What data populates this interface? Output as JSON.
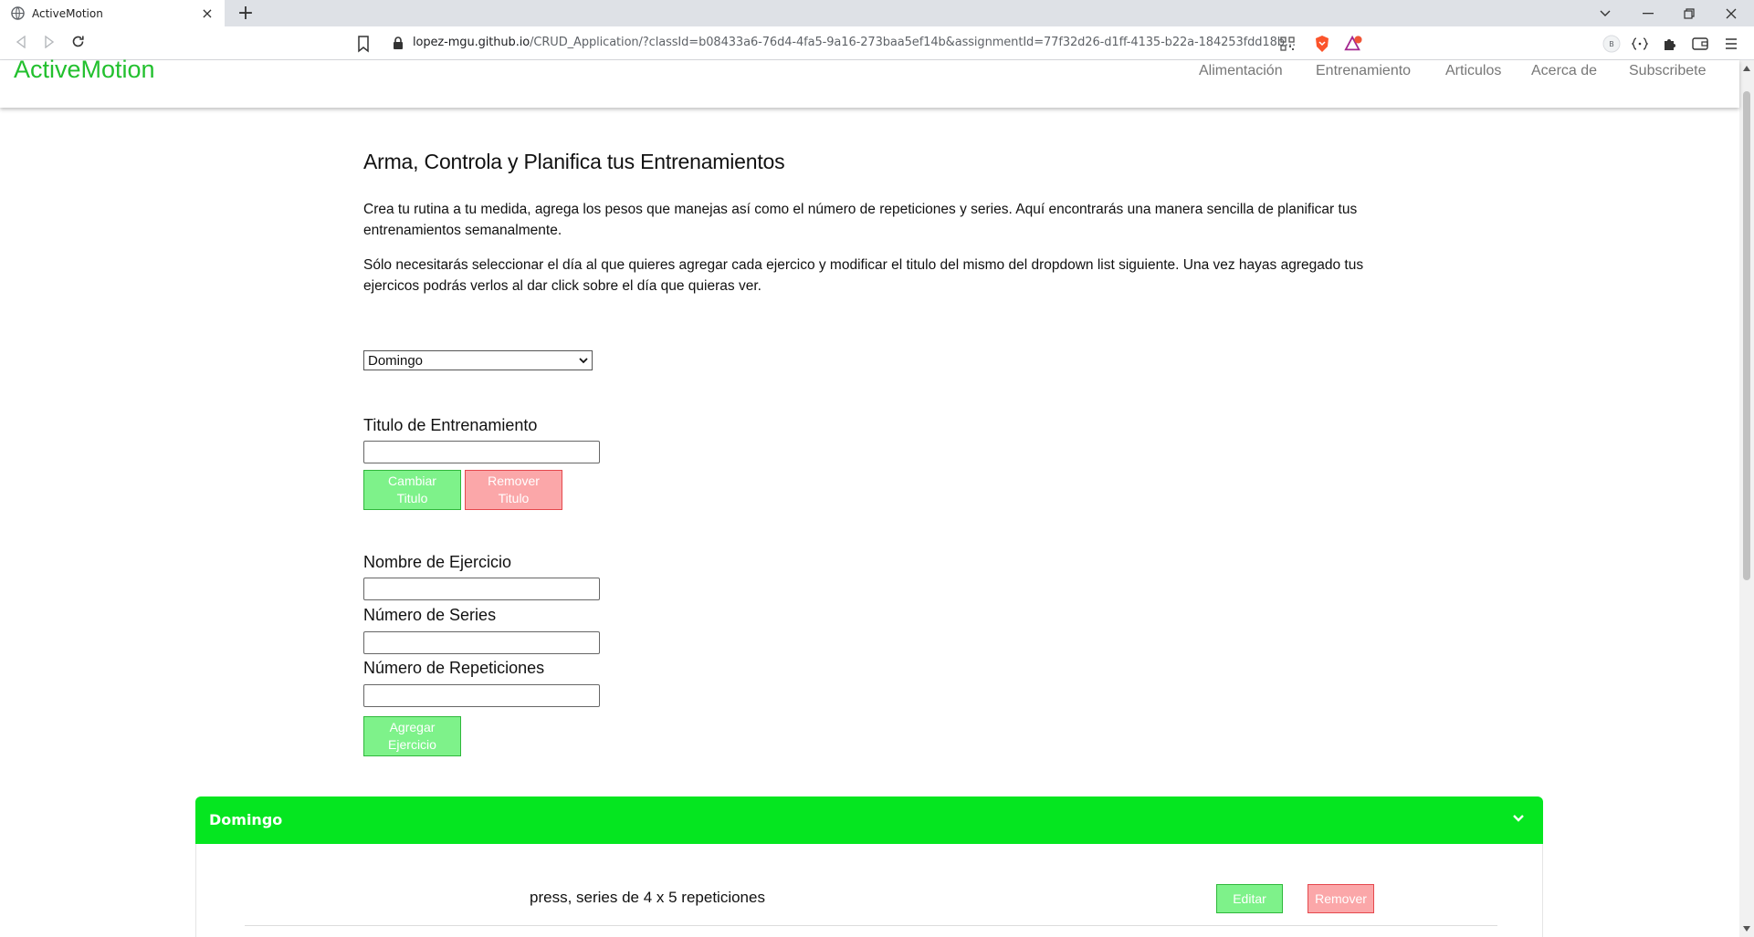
{
  "browser": {
    "tab_title": "ActiveMotion",
    "url_host": "lopez-mgu.github.io",
    "url_path": "/CRUD_Application/?classId=b08433a6-76d4-4fa5-9a16-273baa5ef14b&assignmentId=77f32d26-d1ff-4135-b22a-184253fdd18b...",
    "new_tab": "+",
    "close_tab": "×"
  },
  "header": {
    "brand": "ActiveMotion",
    "nav": [
      "Alimentación",
      "Entrenamiento",
      "Articulos",
      "Acerca de",
      "Subscribete"
    ]
  },
  "intro": {
    "title": "Arma, Controla y Planifica tus Entrenamientos",
    "p1": "Crea tu rutina a tu medida, agrega los pesos que manejas así como el número de repeticiones y series. Aquí encontrarás una manera sencilla de planificar tus entrenamientos semanalmente.",
    "p2": "Sólo necesitarás seleccionar el día al que quieres agregar cada ejercico y modificar el titulo del mismo del dropdown list siguiente. Una vez hayas agregado tus ejercicos podrás verlos al dar click sobre el día que quieras ver."
  },
  "form": {
    "day_selected": "Domingo",
    "title_label": "Titulo de Entrenamiento",
    "change_title": [
      "Cambiar",
      "Titulo"
    ],
    "remove_title": [
      "Remover",
      "Titulo"
    ],
    "exercise_label": "Nombre de Ejercicio",
    "series_label": "Número de Series",
    "reps_label": "Número de Repeticiones",
    "add_exercise": [
      "Agregar",
      "Ejercicio"
    ]
  },
  "accordion": {
    "title": "Domingo",
    "items": [
      {
        "text": "press, series de 4 x 5 repeticiones",
        "edit": "Editar",
        "remove": "Remover"
      }
    ]
  },
  "colors": {
    "brand": "#22c02e",
    "accordion": "#05e620",
    "green_button": "#7ef28a",
    "red_button": "#fba7a9"
  }
}
